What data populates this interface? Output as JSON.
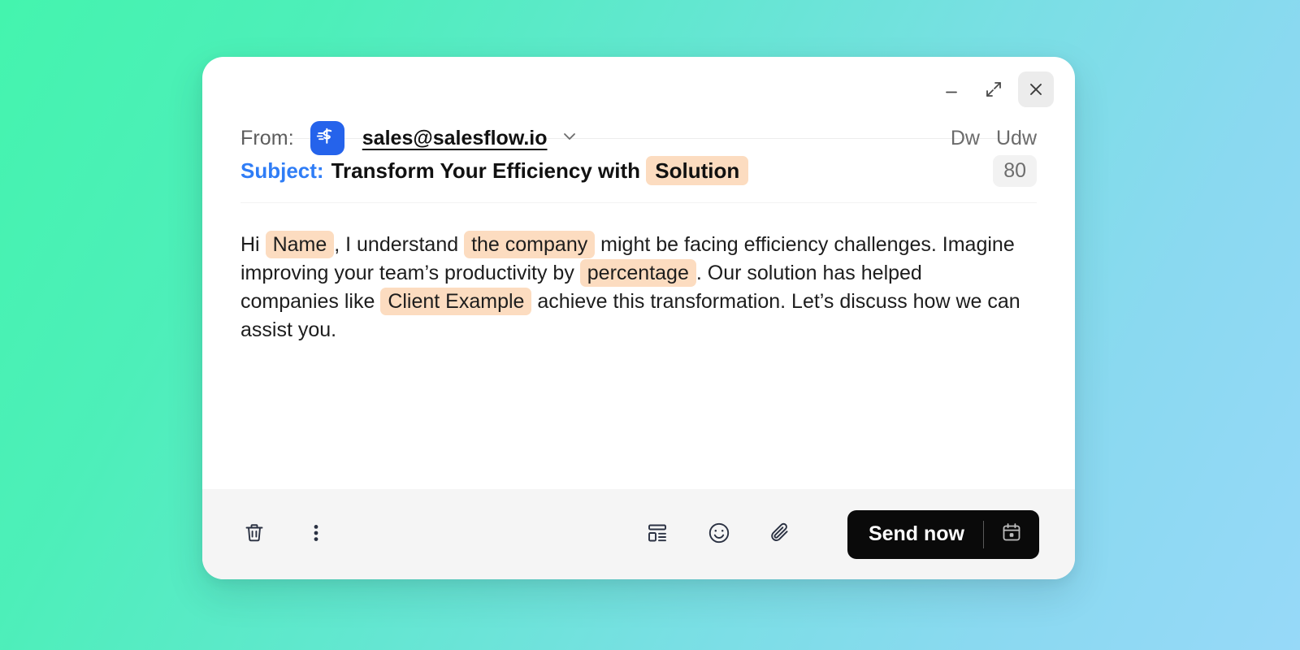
{
  "theme": {
    "background_gradient_from": "#44f4ae",
    "background_gradient_to": "#97d9f8",
    "card_background": "#ffffff",
    "footer_background": "#f5f5f5",
    "accent_blue": "#2f7df6",
    "brand_blue": "#2563eb",
    "token_highlight": "#fcdcc0",
    "send_button_background": "#0a0a0a"
  },
  "window_controls": {
    "minimize_label": "Minimize",
    "expand_label": "Expand",
    "close_label": "Close"
  },
  "from": {
    "label": "From:",
    "email": "sales@salesflow.io",
    "avatar_alt": "salesflow-logo",
    "actions": [
      {
        "label": "Dw"
      },
      {
        "label": "Udw"
      }
    ]
  },
  "subject": {
    "label": "Subject:",
    "text_before_token": "Transform Your Efficiency with ",
    "token": "Solution",
    "char_count": "80"
  },
  "body": {
    "segments": [
      {
        "type": "text",
        "value": "Hi "
      },
      {
        "type": "token",
        "value": "Name"
      },
      {
        "type": "text",
        "value": ", I understand "
      },
      {
        "type": "token",
        "value": "the company"
      },
      {
        "type": "text",
        "value": " might be facing efficiency challenges. Imagine improving your team’s productivity by "
      },
      {
        "type": "token",
        "value": "percentage"
      },
      {
        "type": "text",
        "value": ". Our solution has helped companies like "
      },
      {
        "type": "token",
        "value": "Client Example"
      },
      {
        "type": "text",
        "value": " achieve this transformation. Let’s discuss how we can assist you."
      }
    ],
    "plain_text": "Hi Name, I understand the company might be facing efficiency challenges. Imagine improving your team’s productivity by percentage. Our solution has helped companies like Client Example achieve this transformation. Let’s discuss how we can assist you."
  },
  "footer": {
    "left_icons": [
      {
        "name": "trash-icon",
        "label": "Delete draft"
      },
      {
        "name": "more-options-icon",
        "label": "More options"
      }
    ],
    "right_icons": [
      {
        "name": "template-icon",
        "label": "Insert template"
      },
      {
        "name": "emoji-icon",
        "label": "Insert emoji"
      },
      {
        "name": "attachment-icon",
        "label": "Attach file"
      }
    ],
    "send_label": "Send now",
    "schedule_label": "Schedule send"
  }
}
